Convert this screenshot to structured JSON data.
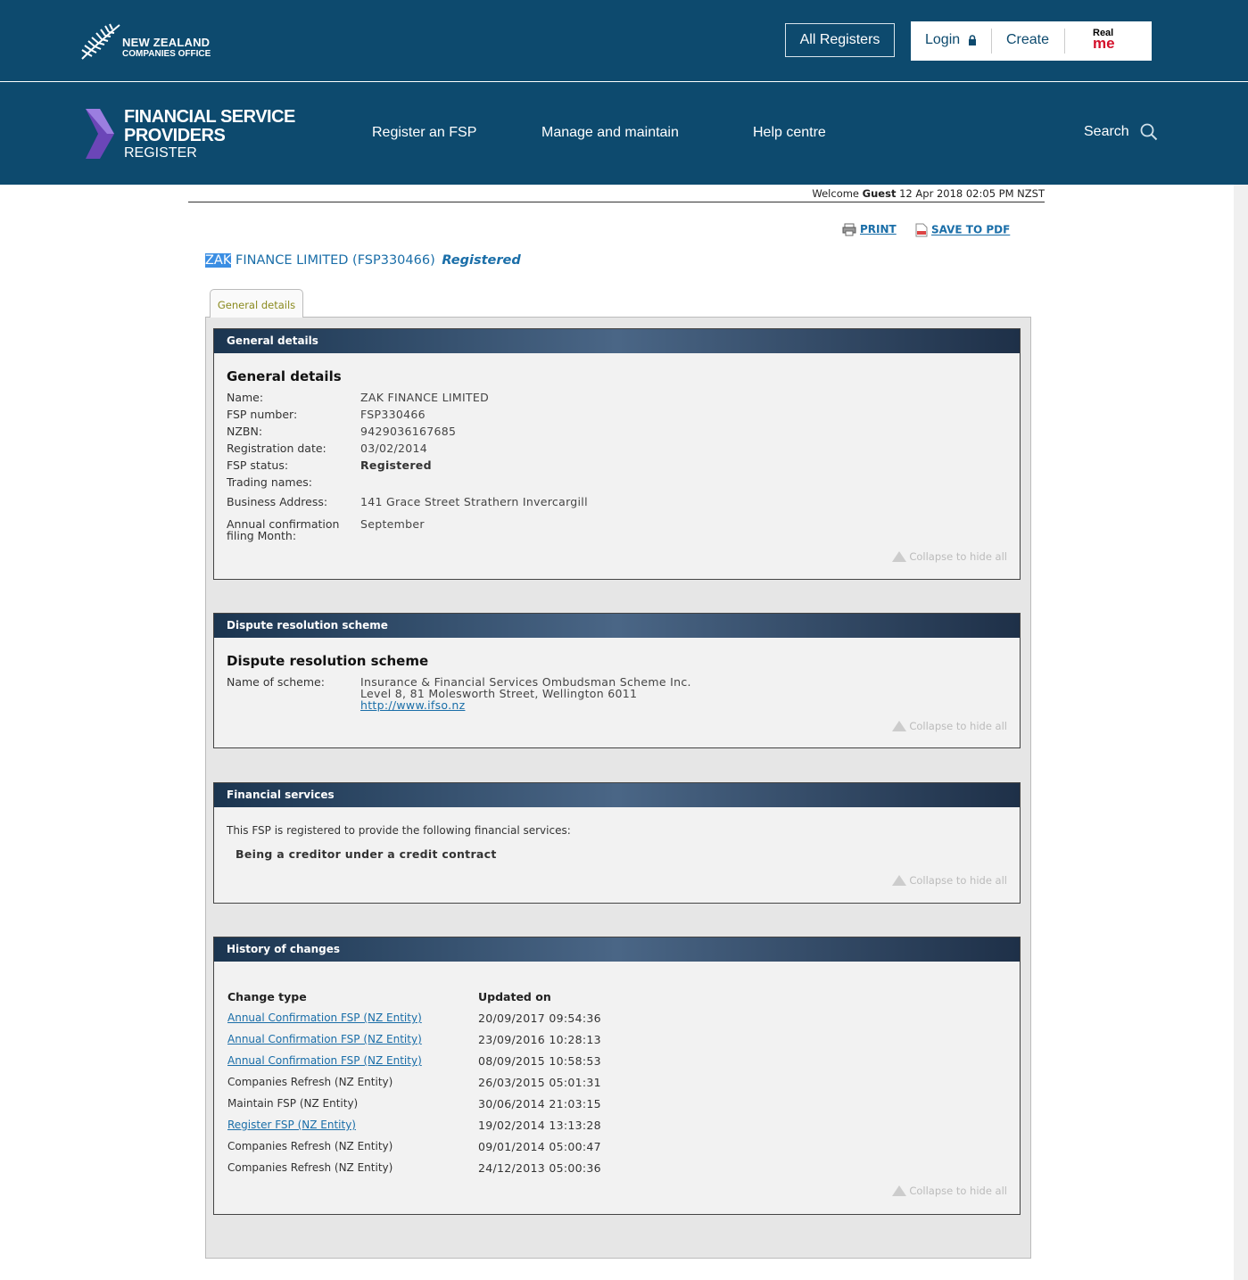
{
  "header": {
    "org_line1": "NEW ZEALAND",
    "org_line2": "COMPANIES OFFICE",
    "all_registers": "All Registers",
    "login": "Login",
    "create": "Create",
    "realme_top": "Real",
    "realme_bottom": "me"
  },
  "nav": {
    "brand_line1": "FINANCIAL SERVICE",
    "brand_line2": "PROVIDERS",
    "brand_line3": "REGISTER",
    "items": [
      "Register an FSP",
      "Manage and maintain",
      "Help centre"
    ],
    "search": "Search"
  },
  "welcome": {
    "prefix": "Welcome",
    "user": "Guest",
    "datetime": "12 Apr 2018 02:05 PM NZST"
  },
  "actions": {
    "print": "PRINT",
    "save_pdf": "SAVE TO PDF"
  },
  "entity": {
    "highlight": "ZAK",
    "rest": " FINANCE LIMITED (FSP330466)",
    "status": "Registered"
  },
  "tabs": {
    "general": "General details"
  },
  "general": {
    "header": "General details",
    "title": "General details",
    "rows": [
      {
        "label": "Name:",
        "value": "ZAK FINANCE LIMITED"
      },
      {
        "label": "FSP number:",
        "value": "FSP330466"
      },
      {
        "label": "NZBN:",
        "value": "9429036167685"
      },
      {
        "label": "Registration date:",
        "value": "03/02/2014"
      },
      {
        "label": "FSP status:",
        "value": "Registered"
      },
      {
        "label": "Trading names:",
        "value": ""
      },
      {
        "label": "Business Address:",
        "value": "141 Grace Street Strathern Invercargill"
      },
      {
        "label": "Annual confirmation",
        "label2": "filing Month:",
        "value": "September"
      }
    ]
  },
  "dispute": {
    "header": "Dispute resolution scheme",
    "title": "Dispute resolution scheme",
    "label": "Name of scheme:",
    "line1": "Insurance & Financial Services Ombudsman Scheme Inc.",
    "line2": "Level 8, 81 Molesworth Street, Wellington 6011",
    "link": "http://www.ifso.nz"
  },
  "services": {
    "header": "Financial services",
    "intro": "This FSP is registered to provide the following financial services:",
    "item": "Being a creditor under a credit contract"
  },
  "history": {
    "header": "History of changes",
    "col_type": "Change type",
    "col_date": "Updated on",
    "rows": [
      {
        "type": "Annual Confirmation FSP (NZ Entity)",
        "date": "20/09/2017 09:54:36",
        "link": true
      },
      {
        "type": "Annual Confirmation FSP (NZ Entity)",
        "date": "23/09/2016 10:28:13",
        "link": true
      },
      {
        "type": "Annual Confirmation FSP (NZ Entity)",
        "date": "08/09/2015 10:58:53",
        "link": true
      },
      {
        "type": "Companies Refresh (NZ Entity)",
        "date": "26/03/2015 05:01:31",
        "link": false
      },
      {
        "type": "Maintain FSP (NZ Entity)",
        "date": "30/06/2014 21:03:15",
        "link": false
      },
      {
        "type": "Register FSP (NZ Entity)",
        "date": "19/02/2014 13:13:28",
        "link": true
      },
      {
        "type": "Companies Refresh (NZ Entity)",
        "date": "09/01/2014 05:00:47",
        "link": false
      },
      {
        "type": "Companies Refresh (NZ Entity)",
        "date": "24/12/2013 05:00:36",
        "link": false
      }
    ]
  },
  "collapse_label": "Collapse to hide all",
  "colors": {
    "brand": "#0d4a6e",
    "link": "#1a6ea8",
    "realme_red": "#d4112b"
  }
}
